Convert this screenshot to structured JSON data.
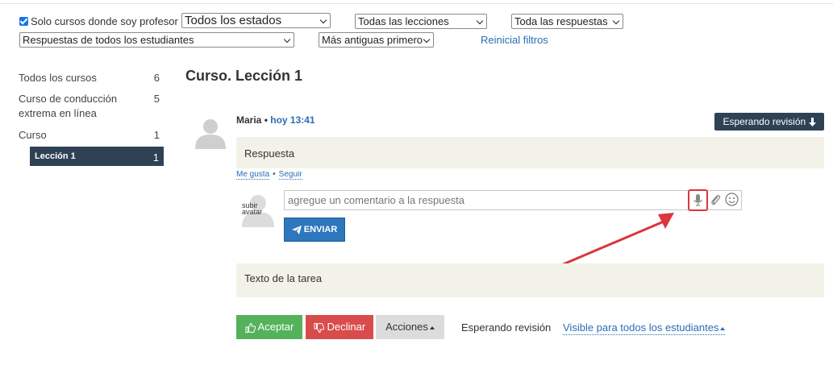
{
  "filters": {
    "checkbox_label": "Solo cursos donde soy profesor",
    "status_select": "Todos los estados",
    "lessons_select": "Todas las lecciones",
    "responses_select": "Toda las respuestas",
    "students_select": "Respuestas de todos los estudiantes",
    "order_select": "Más antiguas primero",
    "reset_label": "Reinicial filtros"
  },
  "sidebar": {
    "items": [
      {
        "label": "Todos los cursos",
        "count": "6"
      },
      {
        "label": "Curso de conducción extrema en línea",
        "count": "5"
      },
      {
        "label": "Curso",
        "count": "1"
      },
      {
        "label": "Lección 1",
        "count": "1"
      }
    ]
  },
  "main": {
    "title": "Curso. Lección 1",
    "post": {
      "author": "Maria",
      "separator": "•",
      "time": "hoy 13:41",
      "status_button": "Esperando revisión",
      "answer": "Respuesta",
      "like": "Me gusta",
      "follow": "Seguir"
    },
    "comment": {
      "avatar_text_1": "subir",
      "avatar_text_2": "avatar",
      "placeholder": "agregue un comentario a la respuesta",
      "send_label": "ENVIAR"
    },
    "task_text": "Texto de la tarea",
    "footer": {
      "accept": "Aceptar",
      "decline": "Declinar",
      "actions": "Acciones",
      "status": "Esperando revisión",
      "visibility": "Visible para todos los estudiantes"
    }
  },
  "colors": {
    "accent": "#2a6db5",
    "dark": "#2f4155",
    "accept": "#54b35a",
    "decline": "#d94c4c",
    "highlight": "#d9363e"
  }
}
